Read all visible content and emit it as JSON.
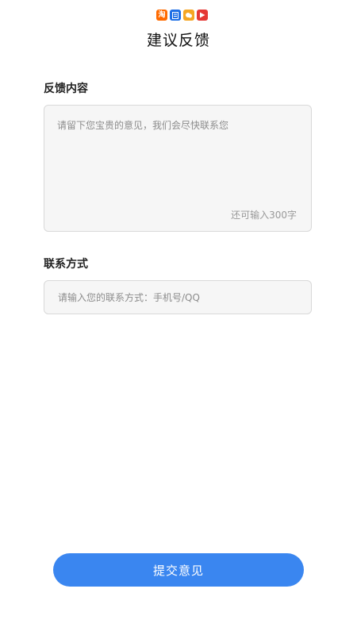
{
  "status_bar": {
    "icons": [
      "taobao-app-icon",
      "document-app-icon",
      "weather-app-icon",
      "video-app-icon"
    ],
    "taobao_glyph": "淘"
  },
  "header": {
    "title": "建议反馈"
  },
  "feedback": {
    "label": "反馈内容",
    "value": "",
    "placeholder": "请留下您宝贵的意见，我们会尽快联系您",
    "counter_text": "还可输入300字",
    "max_chars": 300
  },
  "contact": {
    "label": "联系方式",
    "value": "",
    "placeholder": "请输入您的联系方式：手机号/QQ"
  },
  "actions": {
    "submit_label": "提交意见"
  },
  "colors": {
    "primary": "#3a86f0",
    "field_bg": "#f6f6f6",
    "field_border": "#d9d9d9",
    "placeholder": "#8c8c8c",
    "background": "#ffffff"
  }
}
